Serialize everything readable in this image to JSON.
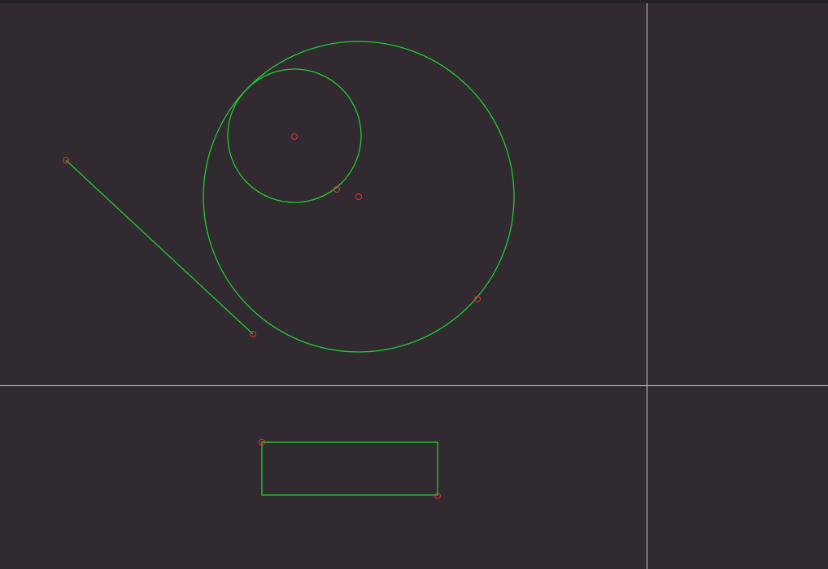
{
  "theme": {
    "background": "#312a30",
    "axis_color": "#c9c6cf",
    "shape_color": "#1fcf2f",
    "grip_color": "#e2353a"
  },
  "drawing": {
    "entities": [
      "line",
      "circle",
      "circle",
      "rectangle"
    ]
  }
}
